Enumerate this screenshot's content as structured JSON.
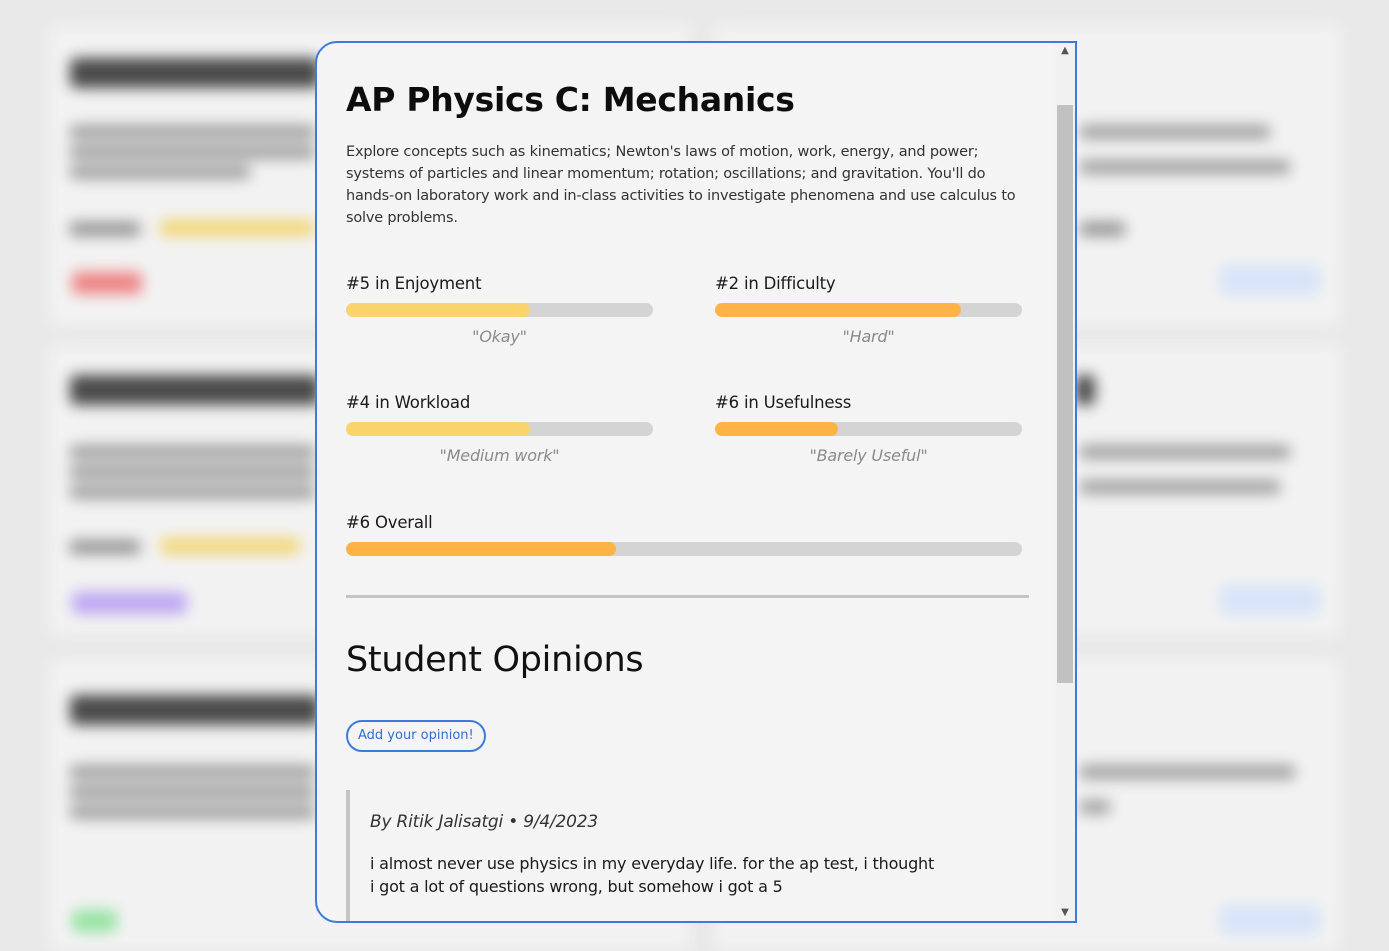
{
  "course": {
    "title": "AP Physics C: Mechanics",
    "description": "Explore concepts such as kinematics; Newton's laws of motion, work, energy, and power; systems of particles and linear momentum; rotation; oscillations; and gravitation. You'll do hands-on laboratory work and in-class activities to investigate phenomena and use calculus to solve problems."
  },
  "ratings": {
    "enjoyment": {
      "label": "#5 in Enjoyment",
      "quote": "\"Okay\"",
      "fraction": 0.6,
      "color": "#f9d46c"
    },
    "difficulty": {
      "label": "#2 in Difficulty",
      "quote": "\"Hard\"",
      "fraction": 0.8,
      "color": "#ffb347"
    },
    "workload": {
      "label": "#4 in Workload",
      "quote": "\"Medium work\"",
      "fraction": 0.6,
      "color": "#f9d46c"
    },
    "usefulness": {
      "label": "#6 in Usefulness",
      "quote": "\"Barely Useful\"",
      "fraction": 0.4,
      "color": "#ffb347"
    },
    "overall": {
      "label": "#6 Overall",
      "fraction": 0.4,
      "color": "#ffb347"
    }
  },
  "opinions_section": {
    "title": "Student Opinions",
    "add_button_label": "Add your opinion!"
  },
  "opinions": [
    {
      "meta": "By Ritik Jalisatgi • 9/4/2023",
      "text": "i almost never use physics in my everyday life. for the ap test, i thought i got a lot of questions wrong, but somehow i got a 5"
    }
  ],
  "scrollbar": {
    "up_icon": "▲",
    "down_icon": "▼"
  },
  "colors": {
    "accent": "#3b7bdc",
    "track": "#d4d4d4"
  }
}
